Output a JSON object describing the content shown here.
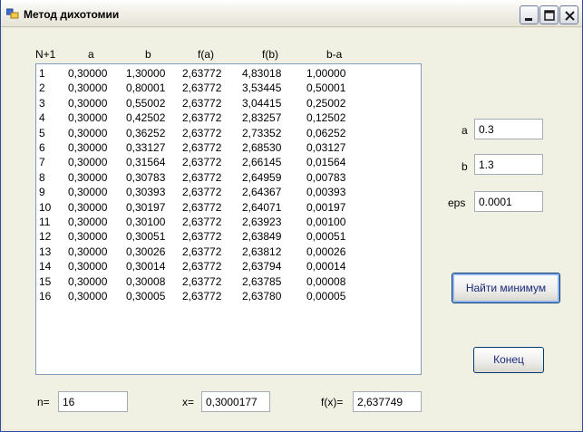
{
  "window": {
    "title": "Метод дихотомии"
  },
  "table": {
    "headers": [
      "N+1",
      "a",
      "b",
      "f(a)",
      "f(b)",
      "b-a"
    ],
    "rows": [
      [
        "1",
        "0,30000",
        "1,30000",
        "2,63772",
        "4,83018",
        "1,00000"
      ],
      [
        "2",
        "0,30000",
        "0,80001",
        "2,63772",
        "3,53445",
        "0,50001"
      ],
      [
        "3",
        "0,30000",
        "0,55002",
        "2,63772",
        "3,04415",
        "0,25002"
      ],
      [
        "4",
        "0,30000",
        "0,42502",
        "2,63772",
        "2,83257",
        "0,12502"
      ],
      [
        "5",
        "0,30000",
        "0,36252",
        "2,63772",
        "2,73352",
        "0,06252"
      ],
      [
        "6",
        "0,30000",
        "0,33127",
        "2,63772",
        "2,68530",
        "0,03127"
      ],
      [
        "7",
        "0,30000",
        "0,31564",
        "2,63772",
        "2,66145",
        "0,01564"
      ],
      [
        "8",
        "0,30000",
        "0,30783",
        "2,63772",
        "2,64959",
        "0,00783"
      ],
      [
        "9",
        "0,30000",
        "0,30393",
        "2,63772",
        "2,64367",
        "0,00393"
      ],
      [
        "10",
        "0,30000",
        "0,30197",
        "2,63772",
        "2,64071",
        "0,00197"
      ],
      [
        "11",
        "0,30000",
        "0,30100",
        "2,63772",
        "2,63923",
        "0,00100"
      ],
      [
        "12",
        "0,30000",
        "0,30051",
        "2,63772",
        "2,63849",
        "0,00051"
      ],
      [
        "13",
        "0,30000",
        "0,30026",
        "2,63772",
        "2,63812",
        "0,00026"
      ],
      [
        "14",
        "0,30000",
        "0,30014",
        "2,63772",
        "2,63794",
        "0,00014"
      ],
      [
        "15",
        "0,30000",
        "0,30008",
        "2,63772",
        "2,63785",
        "0,00008"
      ],
      [
        "16",
        "0,30000",
        "0,30005",
        "2,63772",
        "2,63780",
        "0,00005"
      ]
    ]
  },
  "inputs": {
    "a_label": "a",
    "a_value": "0.3",
    "b_label": "b",
    "b_value": "1.3",
    "eps_label": "eps",
    "eps_value": "0.0001"
  },
  "buttons": {
    "find_min": "Найти минимум",
    "end": "Конец"
  },
  "results": {
    "n_label": "n=",
    "n_value": "16",
    "x_label": "x=",
    "x_value": "0,3000177",
    "fx_label": "f(x)=",
    "fx_value": "2,637749"
  },
  "colors": {
    "form_bg": "#f0f0e3",
    "button_text": "#1c2a7a",
    "primary_focus": "#8fb2ed"
  }
}
